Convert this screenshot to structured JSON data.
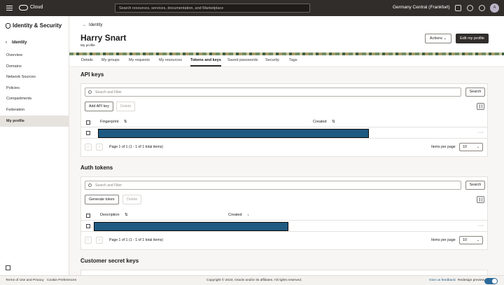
{
  "topbar": {
    "brand": "Cloud",
    "search_placeholder": "Search resources, services, documentation, and Marketplace",
    "region": "Germany Central (Frankfurt)",
    "region_caret": "⌄",
    "avatar_initial": "A"
  },
  "sidebar": {
    "title": "Identity & Security",
    "back_arrow": "‹",
    "back_label": "Identity",
    "items": [
      {
        "label": "Overview"
      },
      {
        "label": "Domains"
      },
      {
        "label": "Network Sources"
      },
      {
        "label": "Policies"
      },
      {
        "label": "Compartments"
      },
      {
        "label": "Federation"
      },
      {
        "label": "My profile",
        "active": true
      }
    ]
  },
  "header": {
    "breadcrumb_arrow": "←",
    "breadcrumb": "Identity",
    "user_name": "Harry Snart",
    "subtitle": "My profile",
    "actions_label": "Actions",
    "actions_caret": "⌄",
    "edit_label": "Edit my profile"
  },
  "tabs": [
    "Details",
    "My groups",
    "My requests",
    "My resources",
    "Tokens and keys",
    "Saved passwords",
    "Security",
    "Tags"
  ],
  "active_tab": "Tokens and keys",
  "api_keys": {
    "title": "API keys",
    "filter_placeholder": "Search and Filter",
    "search_label": "Search",
    "add_label": "Add API key",
    "delete_label": "Delete",
    "col_fingerprint": "Fingerprint",
    "col_created": "Created",
    "sort_icon": "⇅",
    "kebab": "···",
    "prev": "‹",
    "next": "›",
    "page_info": "Page 1 of 1 (1 - 1 of 1 total items)",
    "items_per_page_label": "Items per page",
    "items_per_page": "10",
    "caret": "⌄"
  },
  "auth_tokens": {
    "title": "Auth tokens",
    "filter_placeholder": "Search and Filter",
    "search_label": "Search",
    "generate_label": "Generate token",
    "delete_label": "Delete",
    "col_description": "Description",
    "col_created": "Created",
    "sort_icon": "⇅",
    "sort_desc_icon": "↓",
    "kebab": "···",
    "prev": "‹",
    "next": "›",
    "page_info": "Page 1 of 1 (1 - 1 of 1 total items)",
    "items_per_page_label": "Items per page",
    "items_per_page": "10",
    "caret": "⌄"
  },
  "customer_keys": {
    "title": "Customer secret keys"
  },
  "footer": {
    "terms": "Terms of Use and Privacy",
    "cookies": "Cookie Preferences",
    "copyright": "Copyright © 2023, Oracle and/or its affiliates. All rights reserved.",
    "feedback": "Give us feedback",
    "separator": "|",
    "redesign": "Redesign preview"
  },
  "colors": {
    "topbar": "#312d2a",
    "redaction": "#1f5a82",
    "toggle_on": "#2c6a9a"
  }
}
